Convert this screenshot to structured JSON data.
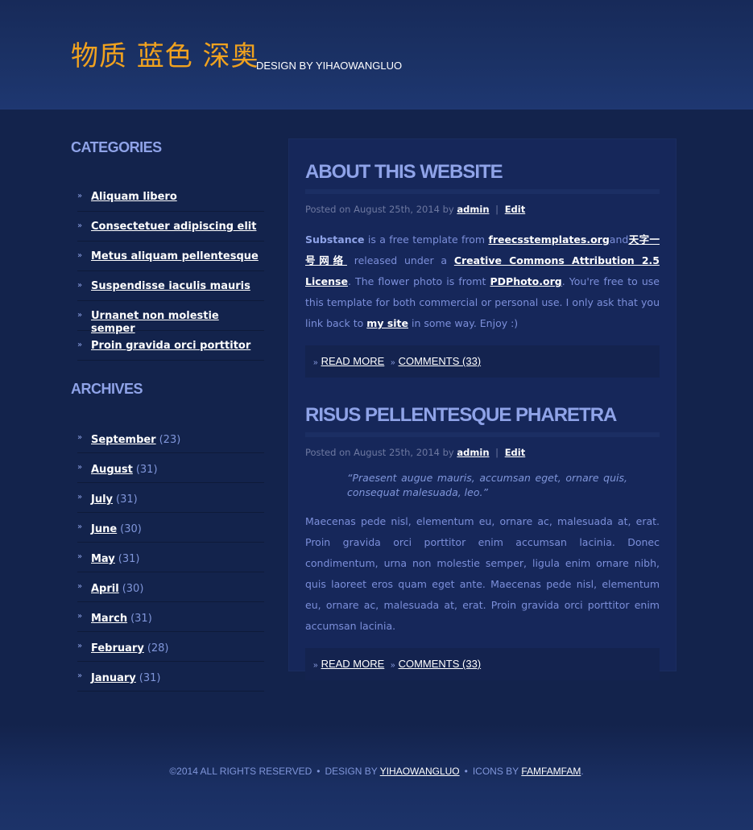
{
  "header": {
    "logo": "物质 蓝色 深奥",
    "tagline": "DESIGN BY YIHAOWANGLUO"
  },
  "sidebar": {
    "categories_title": "CATEGORIES",
    "categories": [
      "Aliquam libero",
      "Consectetuer adipiscing elit",
      "Metus aliquam pellentesque",
      "Suspendisse iaculis mauris",
      "Urnanet non molestie semper",
      "Proin gravida orci porttitor"
    ],
    "archives_title": "ARCHIVES",
    "archives": [
      {
        "month": "September",
        "count": "(23)"
      },
      {
        "month": "August",
        "count": "(31)"
      },
      {
        "month": "July",
        "count": "(31)"
      },
      {
        "month": "June",
        "count": "(30)"
      },
      {
        "month": "May",
        "count": "(31)"
      },
      {
        "month": "April",
        "count": "(30)"
      },
      {
        "month": "March",
        "count": "(31)"
      },
      {
        "month": "February",
        "count": "(28)"
      },
      {
        "month": "January",
        "count": "(31)"
      }
    ]
  },
  "posts": [
    {
      "title": "ABOUT THIS WEBSITE",
      "meta_prefix": "Posted on August 25th, 2014 by",
      "author": "admin",
      "sep": "|",
      "edit": "Edit",
      "body": {
        "substance": "Substance",
        "t1": " is a free template from ",
        "link1": "freecsstemplates.org",
        "t2": "and",
        "link2": "天字一号网络",
        "t3": " released under a ",
        "link3": "Creative Commons Attribution 2.5 License",
        "t4": ". The flower photo is fromt ",
        "link4": "PDPhoto.org",
        "t5": ". You're free to use this template for both commercial or personal use. I only ask that you link back to ",
        "link5": "my site",
        "t6": " in some way. Enjoy :)"
      },
      "read_more": "READ MORE",
      "comments": "COMMENTS (33)"
    },
    {
      "title": "RISUS PELLENTESQUE PHARETRA",
      "meta_prefix": "Posted on August 25th, 2014 by",
      "author": "admin",
      "sep": "|",
      "edit": "Edit",
      "quote": "“Praesent augue mauris, accumsan eget, ornare quis, consequat malesuada, leo.”",
      "body_text": "Maecenas pede nisl, elementum eu, ornare ac, malesuada at, erat. Proin gravida orci porttitor enim accumsan lacinia. Donec condimentum, urna non molestie semper, ligula enim ornare nibh, quis laoreet eros quam eget ante. Maecenas pede nisl, elementum eu, ornare ac, malesuada at, erat. Proin gravida orci porttitor enim accumsan lacinia.",
      "read_more": "READ MORE",
      "comments": "COMMENTS (33)"
    }
  ],
  "footer": {
    "copyright": "©2014 ALL RIGHTS RESERVED",
    "dot": "•",
    "design_by": "DESIGN BY",
    "designer": "YIHAOWANGLUO",
    "icons_by": "ICONS BY",
    "icons_link": "FAMFAMFAM",
    "end": "."
  },
  "icons": {
    "bullet": "»"
  }
}
